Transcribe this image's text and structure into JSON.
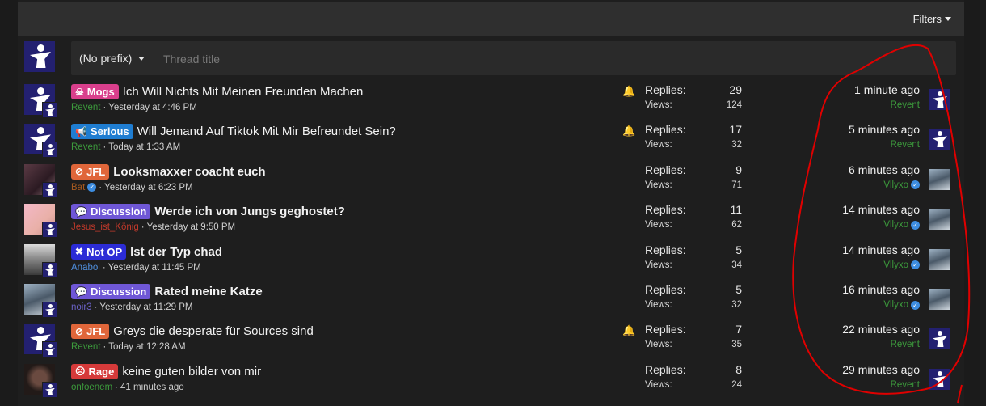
{
  "filter_bar": {
    "filters_label": "Filters"
  },
  "new_thread": {
    "prefix_label": "(No prefix)",
    "title_placeholder": "Thread title"
  },
  "threads": [
    {
      "prefix": {
        "label": "Mogs",
        "icon": "☠",
        "color": "#d93f8c"
      },
      "title": "Ich Will Nichts Mit Meinen Freunden Machen",
      "title_bold": false,
      "author": "Revent",
      "author_class": "",
      "author_verified": false,
      "date": "Yesterday at 4:46 PM",
      "watched": true,
      "replies_label": "Replies:",
      "replies": "29",
      "views_label": "Views:",
      "views": "124",
      "last_time": "1 minute ago",
      "last_user": "Revent",
      "last_user_color": "#3c9a3c",
      "last_verified": false,
      "avatar": "logo",
      "last_avatar": "logo"
    },
    {
      "prefix": {
        "label": "Serious",
        "icon": "📢",
        "color": "#1f7dd1"
      },
      "title": "Will Jemand Auf Tiktok Mit Mir Befreundet Sein?",
      "title_bold": false,
      "author": "Revent",
      "author_class": "",
      "author_verified": false,
      "date": "Today at 1:33 AM",
      "watched": true,
      "replies_label": "Replies:",
      "replies": "17",
      "views_label": "Views:",
      "views": "32",
      "last_time": "5 minutes ago",
      "last_user": "Revent",
      "last_user_color": "#3c9a3c",
      "last_verified": false,
      "avatar": "logo",
      "last_avatar": "logo"
    },
    {
      "prefix": {
        "label": "JFL",
        "icon": "⊘",
        "color": "#e0663a"
      },
      "title": "Looksmaxxer coacht euch",
      "title_bold": true,
      "author": "Bat",
      "author_class": "orange",
      "author_verified": true,
      "date": "Yesterday at 6:23 PM",
      "watched": false,
      "replies_label": "Replies:",
      "replies": "9",
      "views_label": "Views:",
      "views": "71",
      "last_time": "6 minutes ago",
      "last_user": "Vllyxo",
      "last_user_color": "#3c9a3c",
      "last_verified": true,
      "avatar": "photo-dark",
      "last_avatar": "photo-cat"
    },
    {
      "prefix": {
        "label": "Discussion",
        "icon": "💬",
        "color": "#6f57d6"
      },
      "title": "Werde ich von Jungs geghostet?",
      "title_bold": true,
      "author": "Jesus_ist_König",
      "author_class": "red",
      "author_verified": false,
      "date": "Yesterday at 9:50 PM",
      "watched": false,
      "replies_label": "Replies:",
      "replies": "11",
      "views_label": "Views:",
      "views": "62",
      "last_time": "14 minutes ago",
      "last_user": "Vllyxo",
      "last_user_color": "#3c9a3c",
      "last_verified": true,
      "avatar": "photo-pink",
      "last_avatar": "photo-cat"
    },
    {
      "prefix": {
        "label": "Not OP",
        "icon": "✖",
        "color": "#2c2cd6"
      },
      "title": "Ist der Typ chad",
      "title_bold": true,
      "author": "Anabol",
      "author_class": "blue",
      "author_verified": false,
      "date": "Yesterday at 11:45 PM",
      "watched": false,
      "replies_label": "Replies:",
      "replies": "5",
      "views_label": "Views:",
      "views": "34",
      "last_time": "14 minutes ago",
      "last_user": "Vllyxo",
      "last_user_color": "#3c9a3c",
      "last_verified": true,
      "avatar": "photo-room",
      "last_avatar": "photo-cat"
    },
    {
      "prefix": {
        "label": "Discussion",
        "icon": "💬",
        "color": "#6f57d6"
      },
      "title": "Rated meine Katze",
      "title_bold": true,
      "author": "noir3",
      "author_class": "purple",
      "author_verified": false,
      "date": "Yesterday at 11:29 PM",
      "watched": false,
      "replies_label": "Replies:",
      "replies": "5",
      "views_label": "Views:",
      "views": "32",
      "last_time": "16 minutes ago",
      "last_user": "Vllyxo",
      "last_user_color": "#3c9a3c",
      "last_verified": true,
      "avatar": "photo-cat",
      "last_avatar": "photo-cat"
    },
    {
      "prefix": {
        "label": "JFL",
        "icon": "⊘",
        "color": "#e0663a"
      },
      "title": "Greys die desperate für Sources sind",
      "title_bold": false,
      "author": "Revent",
      "author_class": "",
      "author_verified": false,
      "date": "Today at 12:28 AM",
      "watched": true,
      "replies_label": "Replies:",
      "replies": "7",
      "views_label": "Views:",
      "views": "35",
      "last_time": "22 minutes ago",
      "last_user": "Revent",
      "last_user_color": "#3c9a3c",
      "last_verified": false,
      "avatar": "logo",
      "last_avatar": "logo"
    },
    {
      "prefix": {
        "label": "Rage",
        "icon": "☹",
        "color": "#d63a3a"
      },
      "title": "keine guten bilder von mir",
      "title_bold": false,
      "author": "onfoenem",
      "author_class": "",
      "author_verified": false,
      "date": "41 minutes ago",
      "watched": false,
      "replies_label": "Replies:",
      "replies": "8",
      "views_label": "Views:",
      "views": "24",
      "last_time": "29 minutes ago",
      "last_user": "Revent",
      "last_user_color": "#3c9a3c",
      "last_verified": false,
      "avatar": "photo-face",
      "last_avatar": "logo"
    }
  ],
  "colors": {
    "annotation": "#e00000",
    "accent_green": "#3c9a3c",
    "verified_blue": "#3d8de0"
  }
}
